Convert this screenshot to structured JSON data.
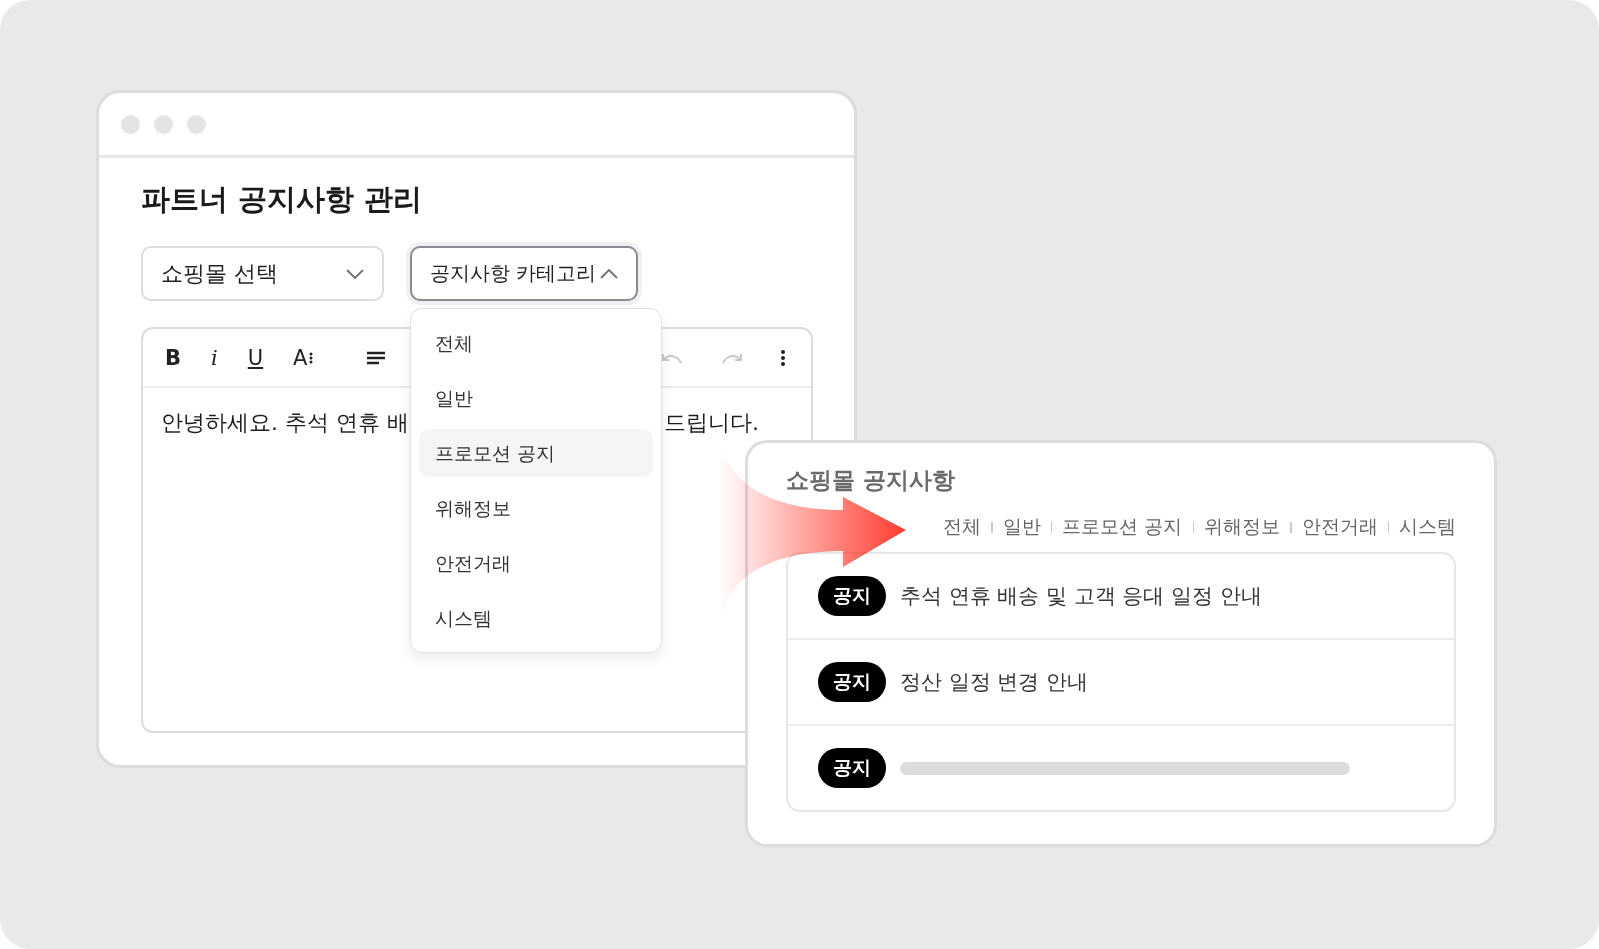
{
  "editor_window": {
    "title": "파트너 공지사항 관리",
    "mall_select": {
      "value": "쇼핑몰 선택",
      "expanded": false
    },
    "category_select": {
      "value": "공지사항 카테고리",
      "expanded": true,
      "options": [
        {
          "label": "전체",
          "selected": false
        },
        {
          "label": "일반",
          "selected": false
        },
        {
          "label": "프로모션 공지",
          "selected": true
        },
        {
          "label": "위해정보",
          "selected": false
        },
        {
          "label": "안전거래",
          "selected": false
        },
        {
          "label": "시스템",
          "selected": false
        }
      ]
    },
    "toolbar": [
      {
        "kind": "bold",
        "label": "B",
        "disabled": false
      },
      {
        "kind": "italic",
        "label": "i",
        "disabled": false
      },
      {
        "kind": "underline",
        "label": "U",
        "disabled": false
      },
      {
        "kind": "size",
        "label": "A",
        "disabled": false
      },
      {
        "kind": "list",
        "disabled": false
      },
      {
        "kind": "undo",
        "disabled": true
      },
      {
        "kind": "redo",
        "disabled": true
      },
      {
        "kind": "more",
        "disabled": false
      }
    ],
    "body_start": "안녕하세요. 추석 연휴 배",
    "body_end": "드립니다."
  },
  "notice_panel": {
    "title": "쇼핑몰 공지사항",
    "tabs": [
      "전체",
      "일반",
      "프로모션 공지",
      "위해정보",
      "안전거래",
      "시스템"
    ],
    "notices": [
      {
        "kind": "text",
        "badge": "공지",
        "title": "추석 연휴 배송 및 고객 응대 일정 안내"
      },
      {
        "kind": "text",
        "badge": "공지",
        "title": "정산 일정 변경 안내"
      },
      {
        "kind": "skeleton",
        "badge": "공지"
      }
    ]
  }
}
